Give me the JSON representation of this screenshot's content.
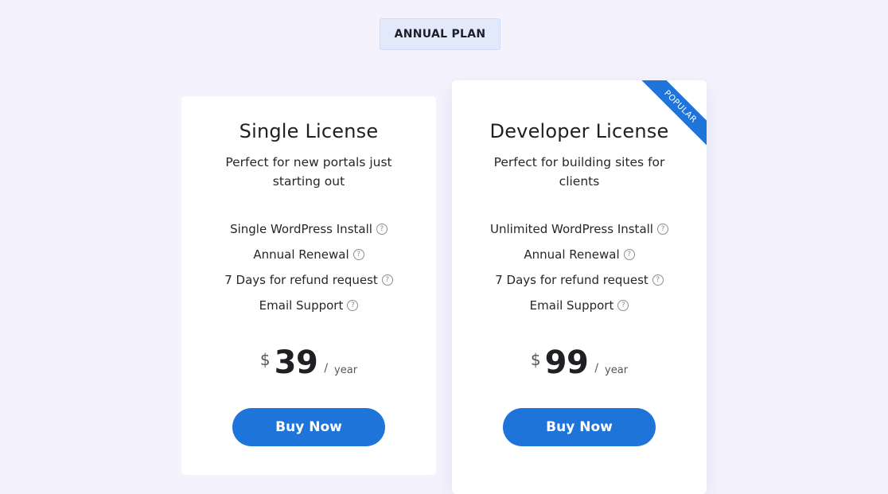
{
  "toggle": {
    "label": "ANNUAL PLAN"
  },
  "plans": [
    {
      "title": "Single License",
      "description": "Perfect for new portals just starting out",
      "features": [
        "Single WordPress Install",
        "Annual Renewal",
        "7 Days for refund request",
        "Email Support"
      ],
      "price": {
        "currency": "$",
        "amount": "39",
        "slash": "/",
        "period": "year"
      },
      "button_label": "Buy Now"
    },
    {
      "title": "Developer License",
      "description": "Perfect for building sites for clients",
      "badge": "POPULAR",
      "features": [
        "Unlimited WordPress Install",
        "Annual Renewal",
        "7 Days for refund request",
        "Email Support"
      ],
      "price": {
        "currency": "$",
        "amount": "99",
        "slash": "/",
        "period": "year"
      },
      "button_label": "Buy Now"
    }
  ],
  "help_glyph": "?",
  "colors": {
    "page_background": "#f4f3fd",
    "accent": "#1e74d9",
    "toggle_background": "#e2e9fb"
  }
}
